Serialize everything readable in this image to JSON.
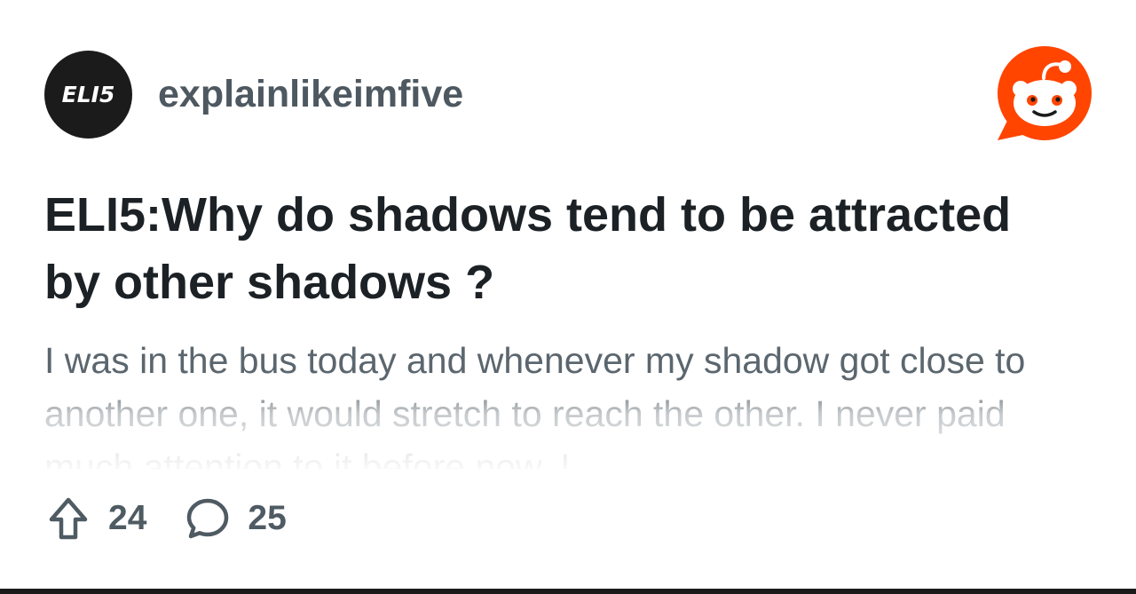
{
  "post": {
    "subreddit": {
      "avatar_text": "ELI5",
      "name": "explainlikeimfive"
    },
    "brand_icon": "reddit-snoo-icon",
    "title": "ELI5:Why do shadows tend to be attracted by other shadows ?",
    "body": "I was in the bus today and whenever my shadow got close to another one, it would stretch to reach the other. I never paid much attention to it before now. I",
    "stats": {
      "upvotes": "24",
      "comments": "25"
    }
  },
  "icons": {
    "upvote": "upvote-arrow-icon",
    "comment": "comment-bubble-icon"
  },
  "colors": {
    "brand_orange": "#ff4500",
    "avatar_background": "#1b1b1b",
    "subreddit_text": "#4d5860",
    "title_text": "#1c2126",
    "body_text": "#5b666e",
    "stat_text": "#4f5b63"
  }
}
